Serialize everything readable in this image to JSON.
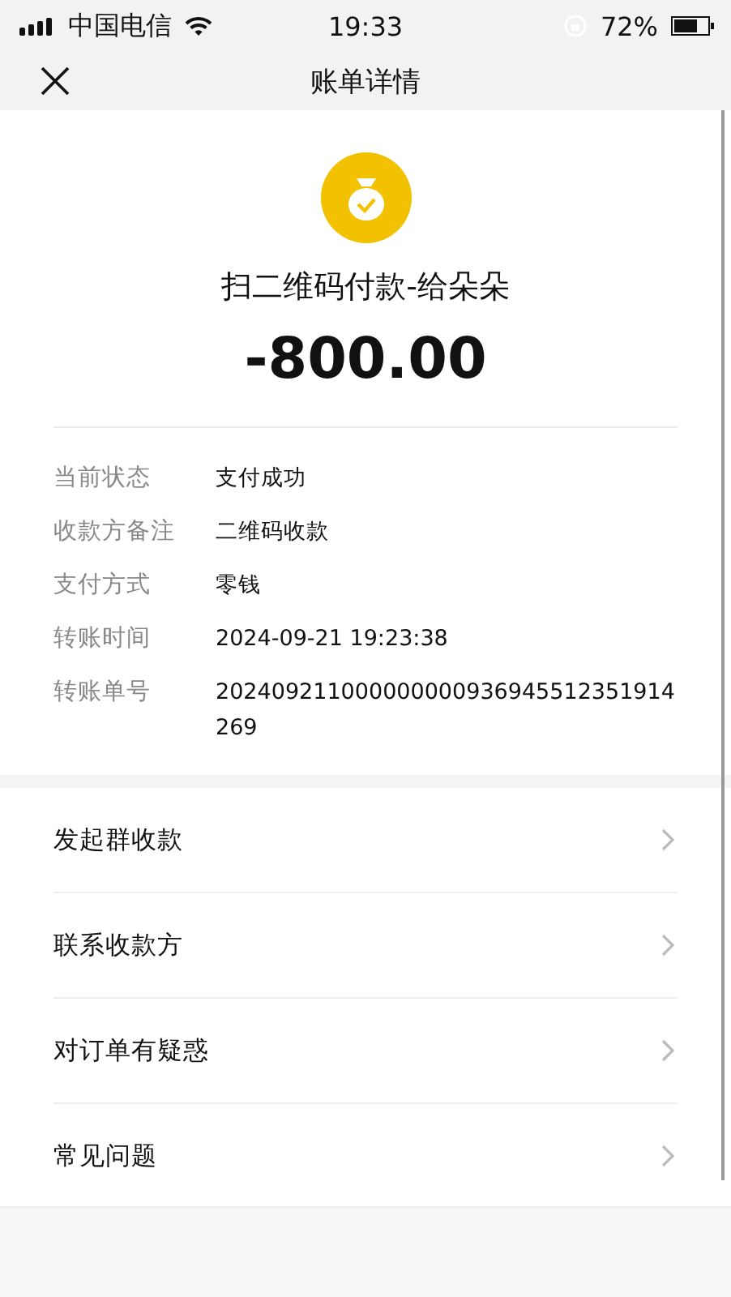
{
  "status_bar": {
    "carrier": "中国电信",
    "time": "19:33",
    "battery": "72%"
  },
  "nav_bar": {
    "title": "账单详情"
  },
  "transaction": {
    "title": "扫二维码付款-给朵朵",
    "amount": "-800.00"
  },
  "details": [
    {
      "label": "当前状态",
      "value": "支付成功"
    },
    {
      "label": "收款方备注",
      "value": "二维码收款"
    },
    {
      "label": "支付方式",
      "value": "零钱"
    },
    {
      "label": "转账时间",
      "value": "2024-09-21 19:23:38"
    },
    {
      "label": "转账单号",
      "value": "202409211000000000936945512351914269"
    }
  ],
  "actions": [
    {
      "label": "发起群收款"
    },
    {
      "label": "联系收款方"
    },
    {
      "label": "对订单有疑惑"
    },
    {
      "label": "常见问题"
    }
  ]
}
